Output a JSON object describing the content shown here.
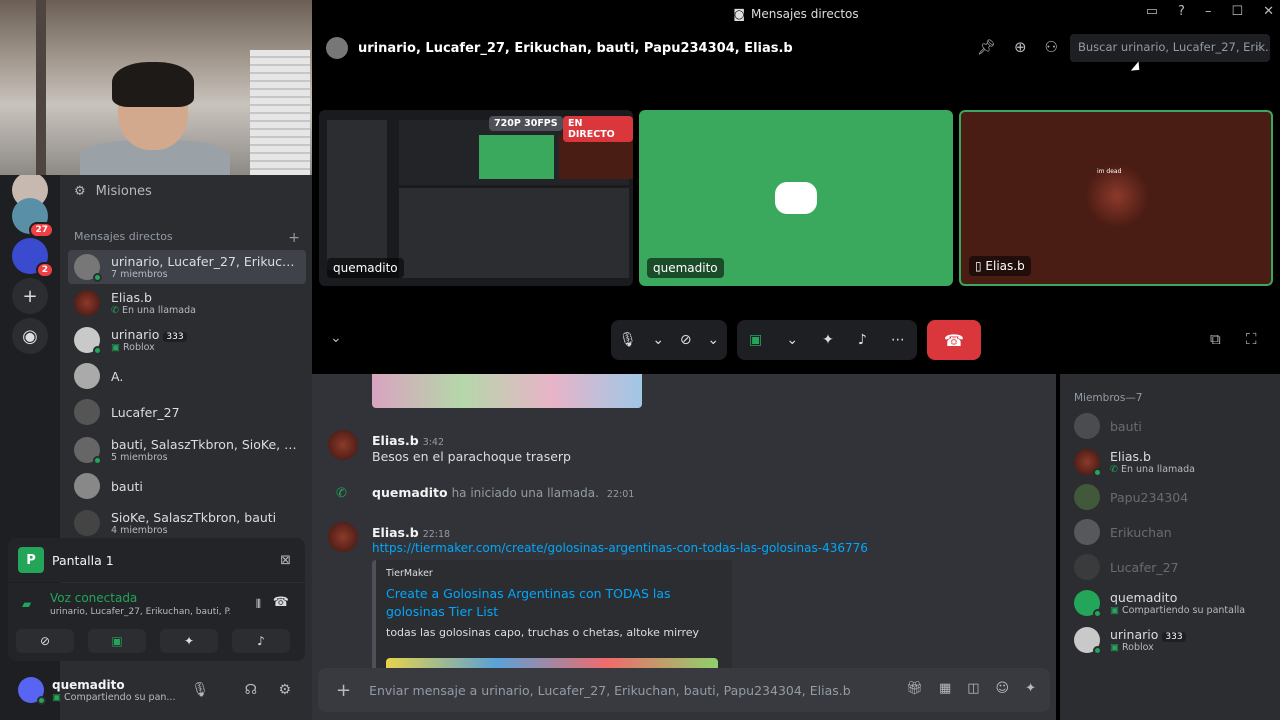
{
  "window": {
    "title": "Mensajes directos"
  },
  "rail": {
    "servers": [
      {
        "badge": "27"
      },
      {
        "badge": "2"
      }
    ]
  },
  "sidebar": {
    "misiones_label": "Misiones",
    "dm_section_label": "Mensajes directos",
    "dms": [
      {
        "name": "urinario, Lucafer_27, Erikucha...",
        "sub": "7 miembros",
        "active": true
      },
      {
        "name": "Elias.b",
        "sub": "En una llamada"
      },
      {
        "name": "urinario",
        "badge": "333",
        "sub": "Roblox"
      },
      {
        "name": "A.",
        "sub": ""
      },
      {
        "name": "Lucafer_27",
        "sub": ""
      },
      {
        "name": "bauti, SalaszTkbron, SioKe, Eli...",
        "sub": "5 miembros"
      },
      {
        "name": "bauti",
        "sub": ""
      },
      {
        "name": "SioKe, SalaszTkbron, bauti",
        "sub": "4 miembros"
      }
    ]
  },
  "screen_panel": {
    "icon_letter": "P",
    "label": "Pantalla 1"
  },
  "voice_panel": {
    "status": "Voz conectada",
    "channel": "urinario, Lucafer_27, Erikuchan, bauti, P..."
  },
  "user_panel": {
    "name": "quemadito",
    "status": "Compartiendo su pan..."
  },
  "call": {
    "header_name": "urinario, Lucafer_27, Erikuchan, bauti, Papu234304, Elias.b",
    "search_placeholder": "Buscar urinario, Lucafer_27, Erik...",
    "tiles": [
      {
        "label": "quemadito",
        "quality": "720P 30FPS",
        "live": "EN DIRECTO"
      },
      {
        "label": "quemadito"
      },
      {
        "label": "Elias.b",
        "overlay": "im dead"
      }
    ]
  },
  "chat": {
    "messages": [
      {
        "author": "Elias.b",
        "time": "3:42",
        "text": "Besos en el parachoque traserp"
      },
      {
        "author": "quemadito",
        "system_text": "ha iniciado una llamada.",
        "time": "22:01"
      },
      {
        "author": "Elias.b",
        "time": "22:18",
        "link": "https://tiermaker.com/create/golosinas-argentinas-con-todas-las-golosinas-436776"
      }
    ],
    "embed": {
      "provider": "TierMaker",
      "title": "Create a Golosinas Argentinas con TODAS las golosinas Tier List",
      "description": "todas las golosinas capo, truchas o chetas, altoke mirrey"
    },
    "input_placeholder": "Enviar mensaje a urinario, Lucafer_27, Erikuchan, bauti, Papu234304, Elias.b"
  },
  "members": {
    "header": "Miembros—7",
    "list": [
      {
        "name": "bauti",
        "dim": true
      },
      {
        "name": "Elias.b",
        "sub": "En una llamada"
      },
      {
        "name": "Papu234304",
        "dim": true
      },
      {
        "name": "Erikuchan",
        "dim": true
      },
      {
        "name": "Lucafer_27",
        "dim": true
      },
      {
        "name": "quemadito",
        "sub": "Compartiendo su pantalla"
      },
      {
        "name": "urinario",
        "badge": "333",
        "sub": "Roblox"
      }
    ]
  },
  "colors": {
    "green": "#23a55a",
    "red": "#da373c",
    "blurple": "#5865f2",
    "link": "#00a8fc"
  }
}
